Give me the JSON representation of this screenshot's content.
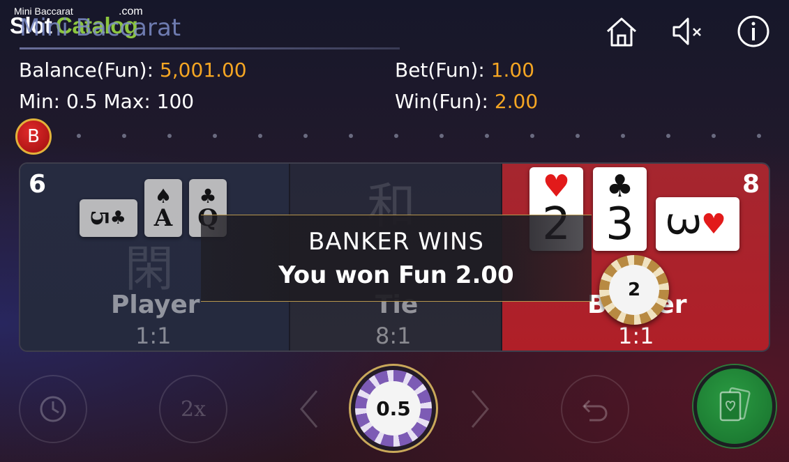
{
  "watermark": {
    "small": "Mini Baccarat",
    "slot": "Slot",
    "catalog": "Catalog",
    "com": ".com"
  },
  "header": {
    "title": "Mini Baccarat"
  },
  "top_icons": [
    "home-icon",
    "sound-muted-icon",
    "info-icon"
  ],
  "info": {
    "balance_label": "Balance(Fun): ",
    "balance_value": "5,001.00",
    "limits": "Min: 0.5 Max: 100",
    "bet_label": "Bet(Fun): ",
    "bet_value": "1.00",
    "win_label": "Win(Fun): ",
    "win_value": "2.00"
  },
  "road": {
    "last_result": "B"
  },
  "table": {
    "player": {
      "label": "Player",
      "odds": "1:1",
      "ghost": "閑",
      "score": "6"
    },
    "tie": {
      "label": "Tie",
      "odds": "8:1",
      "ghost": "和"
    },
    "banker": {
      "label": "Banker",
      "odds": "1:1",
      "score": "8"
    }
  },
  "cards": {
    "player": [
      {
        "rank": "5",
        "suit": "♣"
      },
      {
        "rank": "A",
        "suit": "♠"
      },
      {
        "rank": "Q",
        "suit": "♣"
      }
    ],
    "banker": [
      {
        "rank": "2",
        "suit": "♥"
      },
      {
        "rank": "3",
        "suit": "♣"
      },
      {
        "rank": "3",
        "suit": "♥"
      }
    ]
  },
  "result": {
    "title": "BANKER WINS",
    "message": "You won Fun 2.00"
  },
  "bet_chip": {
    "value": "2"
  },
  "controls": {
    "selected_chip": "0.5",
    "double_label": "2x"
  },
  "colors": {
    "accent": "#f5a623",
    "banker": "#b01f28",
    "deal": "#1f8a37"
  }
}
